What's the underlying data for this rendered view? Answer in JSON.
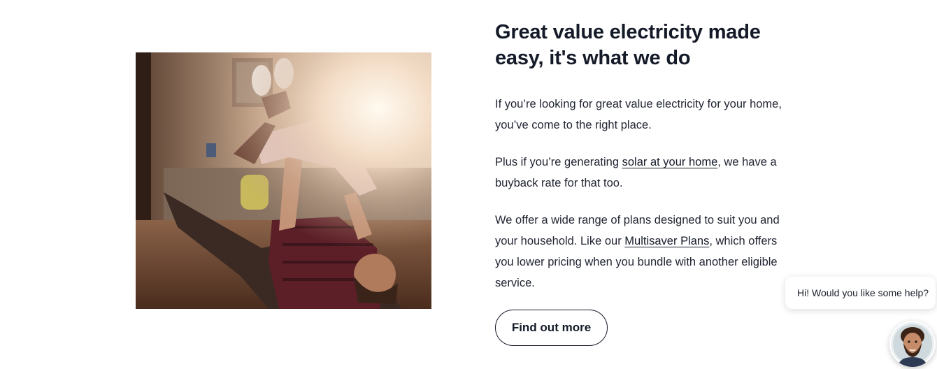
{
  "headline": "Great value electricity made easy, it's what we do",
  "paragraph1": "If you’re looking for great value electricity for your home, you’ve come to the right place.",
  "paragraph2": {
    "before": "Plus if you’re generating ",
    "link": "solar at your home",
    "after": ", we have a buyback rate for that too."
  },
  "paragraph3": {
    "before": "We offer a wide range of plans designed to suit you and your household. Like our ",
    "link": "Multisaver Plans",
    "after": ", which offers you lower pricing when you bundle with another eligible service."
  },
  "cta_label": "Find out more",
  "chat": {
    "prompt": "Hi! Would you like some help?",
    "avatar_icon": "agent-avatar-icon"
  },
  "photo": {
    "icon": "family-photo"
  },
  "colors": {
    "text": "#141a28",
    "background": "#ffffff",
    "link": "#141a28"
  }
}
